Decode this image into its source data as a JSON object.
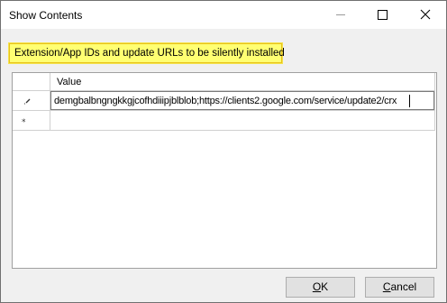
{
  "window": {
    "title": "Show Contents"
  },
  "titlebar_buttons": {
    "minimize_icon": "minimize-icon",
    "maximize_icon": "maximize-icon",
    "close_icon": "close-icon"
  },
  "description": {
    "text": "Extension/App IDs and update URLs to be silently installed"
  },
  "grid": {
    "columns": [
      "Value"
    ],
    "rows": [
      {
        "indicator": "pencil-icon",
        "value": "demgbalbngngkkgjcofhdiiipjblblob;https://clients2.google.com/service/update2/crx",
        "editing": true
      },
      {
        "indicator": "new-row-icon",
        "value": "",
        "editing": false
      }
    ]
  },
  "buttons": {
    "ok_access_key": "O",
    "ok_rest": "K",
    "cancel_access_key": "C",
    "cancel_rest": "ancel"
  },
  "colors": {
    "highlight": "#ffff72",
    "highlight_border": "#e8c21a",
    "window_bg": "#f0f0f0"
  }
}
